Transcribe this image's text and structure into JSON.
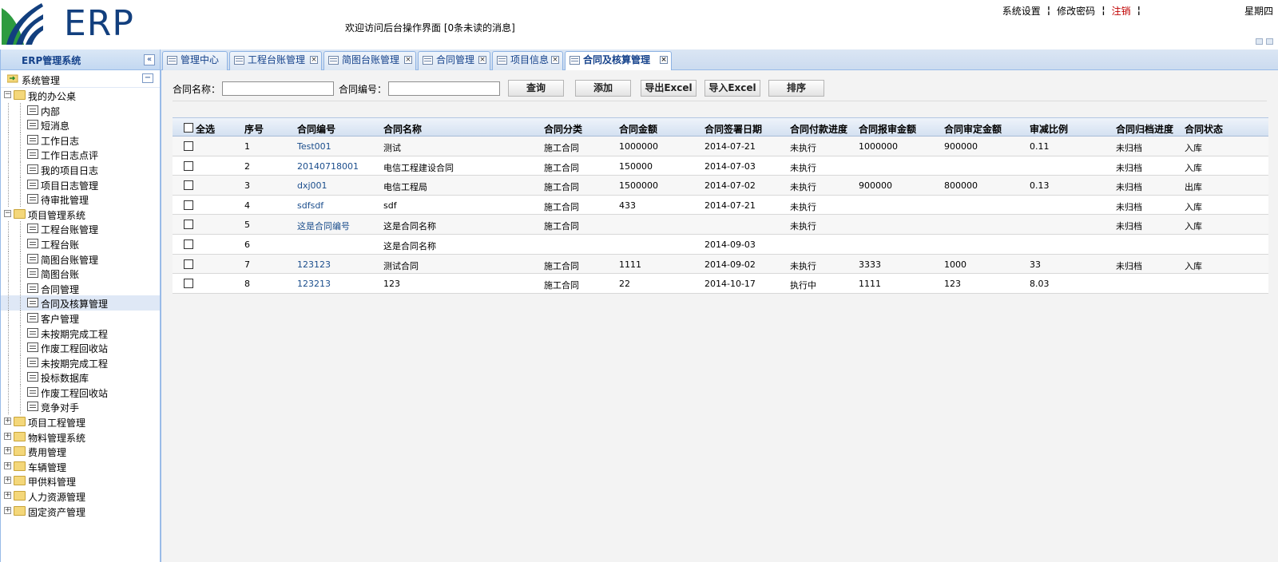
{
  "header": {
    "logo_text": "ERP",
    "welcome": "欢迎访问后台操作界面 [0条未读的消息]",
    "links": [
      "系统设置",
      "修改密码",
      "注销"
    ],
    "weekday": "星期四",
    "colors": {
      "logo": "#123f7e",
      "logout": "#c00000"
    }
  },
  "sidebar": {
    "title": "ERP管理系统",
    "collapse_icon": "«",
    "root": "系统管理",
    "tree": [
      {
        "label": "我的办公桌",
        "level": 0,
        "type": "folder",
        "expanded": true
      },
      {
        "label": "内部",
        "level": 1,
        "type": "page"
      },
      {
        "label": "短消息",
        "level": 1,
        "type": "page"
      },
      {
        "label": "工作日志",
        "level": 1,
        "type": "page"
      },
      {
        "label": "工作日志点评",
        "level": 1,
        "type": "page"
      },
      {
        "label": "我的项目日志",
        "level": 1,
        "type": "page"
      },
      {
        "label": "项目日志管理",
        "level": 1,
        "type": "page"
      },
      {
        "label": "待审批管理",
        "level": 1,
        "type": "page"
      },
      {
        "label": "项目管理系统",
        "level": 0,
        "type": "folder",
        "expanded": true
      },
      {
        "label": "工程台账管理",
        "level": 1,
        "type": "page"
      },
      {
        "label": "工程台账",
        "level": 1,
        "type": "page"
      },
      {
        "label": "简图台账管理",
        "level": 1,
        "type": "page"
      },
      {
        "label": "简图台账",
        "level": 1,
        "type": "page"
      },
      {
        "label": "合同管理",
        "level": 1,
        "type": "page"
      },
      {
        "label": "合同及核算管理",
        "level": 1,
        "type": "page",
        "selected": true
      },
      {
        "label": "客户管理",
        "level": 1,
        "type": "page"
      },
      {
        "label": "未按期完成工程",
        "level": 1,
        "type": "page"
      },
      {
        "label": "作废工程回收站",
        "level": 1,
        "type": "page"
      },
      {
        "label": "未按期完成工程",
        "level": 1,
        "type": "page"
      },
      {
        "label": "投标数据库",
        "level": 1,
        "type": "page"
      },
      {
        "label": "作废工程回收站",
        "level": 1,
        "type": "page"
      },
      {
        "label": "竞争对手",
        "level": 1,
        "type": "page"
      },
      {
        "label": "项目工程管理",
        "level": 0,
        "type": "folder",
        "expanded": false
      },
      {
        "label": "物料管理系统",
        "level": 0,
        "type": "folder",
        "expanded": false
      },
      {
        "label": "费用管理",
        "level": 0,
        "type": "folder",
        "expanded": false
      },
      {
        "label": "车辆管理",
        "level": 0,
        "type": "folder",
        "expanded": false
      },
      {
        "label": "甲供料管理",
        "level": 0,
        "type": "folder",
        "expanded": false
      },
      {
        "label": "人力资源管理",
        "level": 0,
        "type": "folder",
        "expanded": false
      },
      {
        "label": "固定资产管理",
        "level": 0,
        "type": "folder",
        "expanded": false
      }
    ]
  },
  "tabs": [
    {
      "label": "管理中心",
      "closable": false
    },
    {
      "label": "工程台账管理",
      "closable": true
    },
    {
      "label": "简图台账管理",
      "closable": true
    },
    {
      "label": "合同管理",
      "closable": true
    },
    {
      "label": "项目信息",
      "closable": true
    },
    {
      "label": "合同及核算管理",
      "closable": true,
      "active": true
    }
  ],
  "search": {
    "name_label": "合同名称：",
    "name_value": "",
    "number_label": "合同编号：",
    "number_value": "",
    "query_button": "查询",
    "add_button": "添加",
    "export_button": "导出Excel",
    "import_button": "导入Excel",
    "sort_button": "排序"
  },
  "table": {
    "select_all": "全选",
    "columns": [
      "序号",
      "合同编号",
      "合同名称",
      "合同分类",
      "合同金额",
      "合同签署日期",
      "合同付款进度",
      "合同报审金额",
      "合同审定金额",
      "审减比例",
      "合同归档进度",
      "合同状态"
    ],
    "rows": [
      [
        "1",
        "Test001",
        "测试",
        "施工合同",
        "1000000",
        "2014-07-21",
        "未执行",
        "1000000",
        "900000",
        "0.11",
        "未归档",
        "入库"
      ],
      [
        "2",
        "20140718001",
        "电信工程建设合同",
        "施工合同",
        "150000",
        "2014-07-03",
        "未执行",
        "",
        "",
        "",
        "未归档",
        "入库"
      ],
      [
        "3",
        "dxj001",
        "电信工程局",
        "施工合同",
        "1500000",
        "2014-07-02",
        "未执行",
        "900000",
        "800000",
        "0.13",
        "未归档",
        "出库"
      ],
      [
        "4",
        "sdfsdf",
        "sdf",
        "施工合同",
        "433",
        "2014-07-21",
        "未执行",
        "",
        "",
        "",
        "未归档",
        "入库"
      ],
      [
        "5",
        "这是合同编号",
        "这是合同名称",
        "施工合同",
        "",
        "",
        "未执行",
        "",
        "",
        "",
        "未归档",
        "入库"
      ],
      [
        "6",
        "",
        "这是合同名称",
        "",
        "",
        "2014-09-03",
        "",
        "",
        "",
        "",
        "",
        ""
      ],
      [
        "7",
        "123123",
        "测试合同",
        "施工合同",
        "1111",
        "2014-09-02",
        "未执行",
        "3333",
        "1000",
        "33",
        "未归档",
        "入库"
      ],
      [
        "8",
        "123213",
        "123",
        "施工合同",
        "22",
        "2014-10-17",
        "执行中",
        "1111",
        "123",
        "8.03",
        "",
        ""
      ]
    ]
  }
}
